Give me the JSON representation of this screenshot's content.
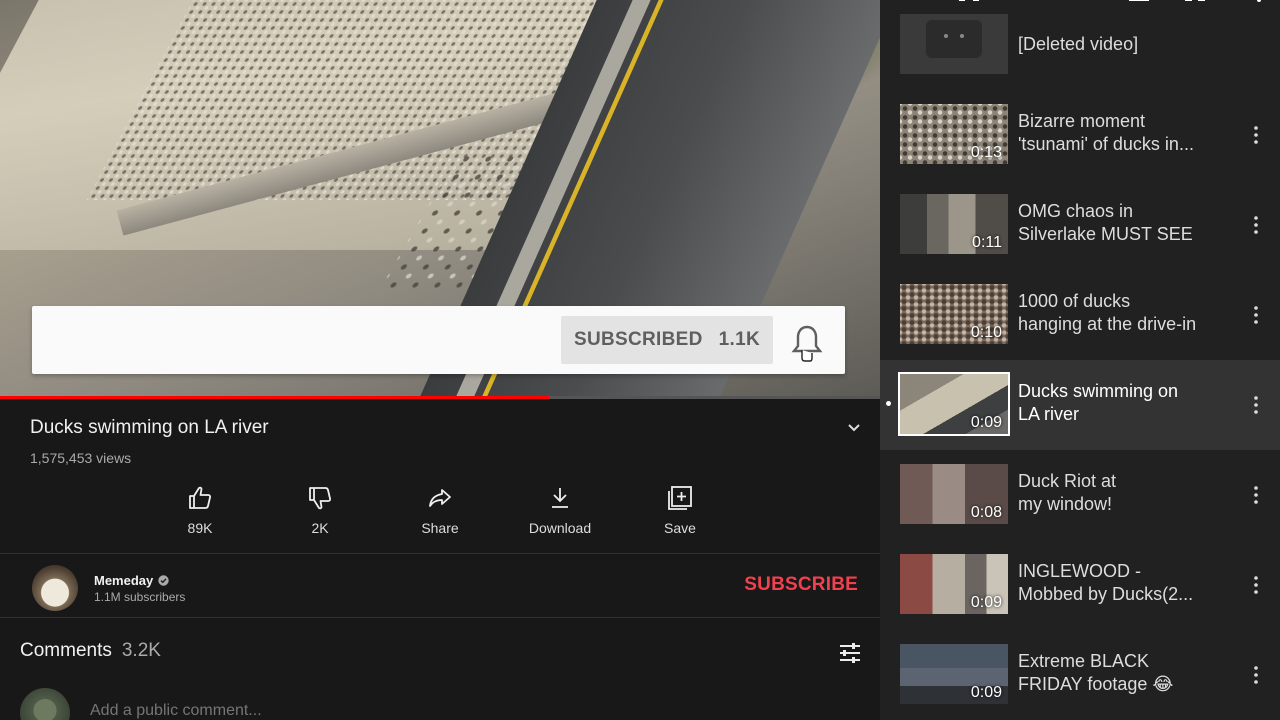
{
  "video": {
    "title": "Ducks swimming on LA river",
    "views": "1,575,453 views",
    "progress_fraction": 0.624,
    "overlay": {
      "subscribed_label": "SUBSCRIBED",
      "subscribed_count": "1.1K"
    }
  },
  "actions": {
    "like": "89K",
    "dislike": "2K",
    "share": "Share",
    "download": "Download",
    "save": "Save"
  },
  "channel": {
    "name": "Memeday",
    "subscribers": "1.1M subscribers",
    "subscribe_label": "SUBSCRIBE",
    "subscribe_color": "#f1414e"
  },
  "comments": {
    "label": "Comments",
    "count": "3.2K",
    "placeholder": "Add a public comment..."
  },
  "playlist": {
    "items": [
      {
        "title": "[Deleted video]",
        "duration": "",
        "thumb": "deleted"
      },
      {
        "title": "Bizarre moment\n'tsunami' of ducks in...",
        "duration": "0:13",
        "thumb": "ducks"
      },
      {
        "title": "OMG chaos in\nSilverlake MUST SEE",
        "duration": "0:11",
        "thumb": "street"
      },
      {
        "title": "1000 of ducks\nhanging at the drive-in",
        "duration": "0:10",
        "thumb": "drivein"
      },
      {
        "title": "Ducks swimming on\nLA river",
        "duration": "0:09",
        "thumb": "river",
        "active": true
      },
      {
        "title": "Duck Riot at\nmy window!",
        "duration": "0:08",
        "thumb": "window"
      },
      {
        "title": "INGLEWOOD -\nMobbed by Ducks(2...",
        "duration": "0:09",
        "thumb": "inglewood"
      },
      {
        "title": "Extreme BLACK\nFRIDAY footage 😂",
        "duration": "0:09",
        "thumb": "friday"
      }
    ]
  },
  "colors": {
    "progress": "#ff0000",
    "background": "#181818",
    "playlist_background": "#212121",
    "active_item": "#333333"
  }
}
